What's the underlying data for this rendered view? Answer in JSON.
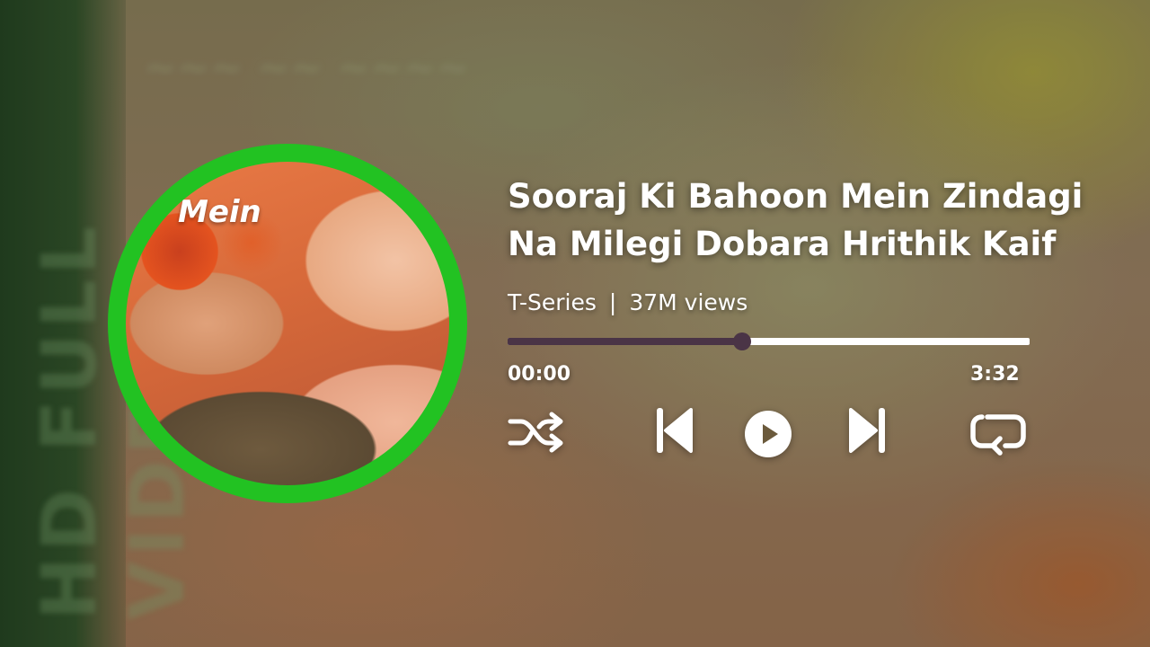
{
  "player": {
    "title_line1": "Sooraj Ki Bahoon Mein Zindagi",
    "title_line2": "Na Milegi Dobara Hrithik Kaif",
    "channel": "T-Series",
    "separator": "|",
    "views": "37M views",
    "current_time": "00:00",
    "duration": "3:32",
    "progress_fraction": 0.45,
    "art_text": "Mein"
  },
  "controls": {
    "shuffle": "shuffle-icon",
    "previous": "skip-previous-icon",
    "play": "play-icon",
    "next": "skip-next-icon",
    "repeat": "repeat-icon"
  },
  "colors": {
    "ring": "#22c222",
    "progress_played": "#4a3446",
    "progress_track": "#ffffff",
    "text": "#ffffff"
  }
}
